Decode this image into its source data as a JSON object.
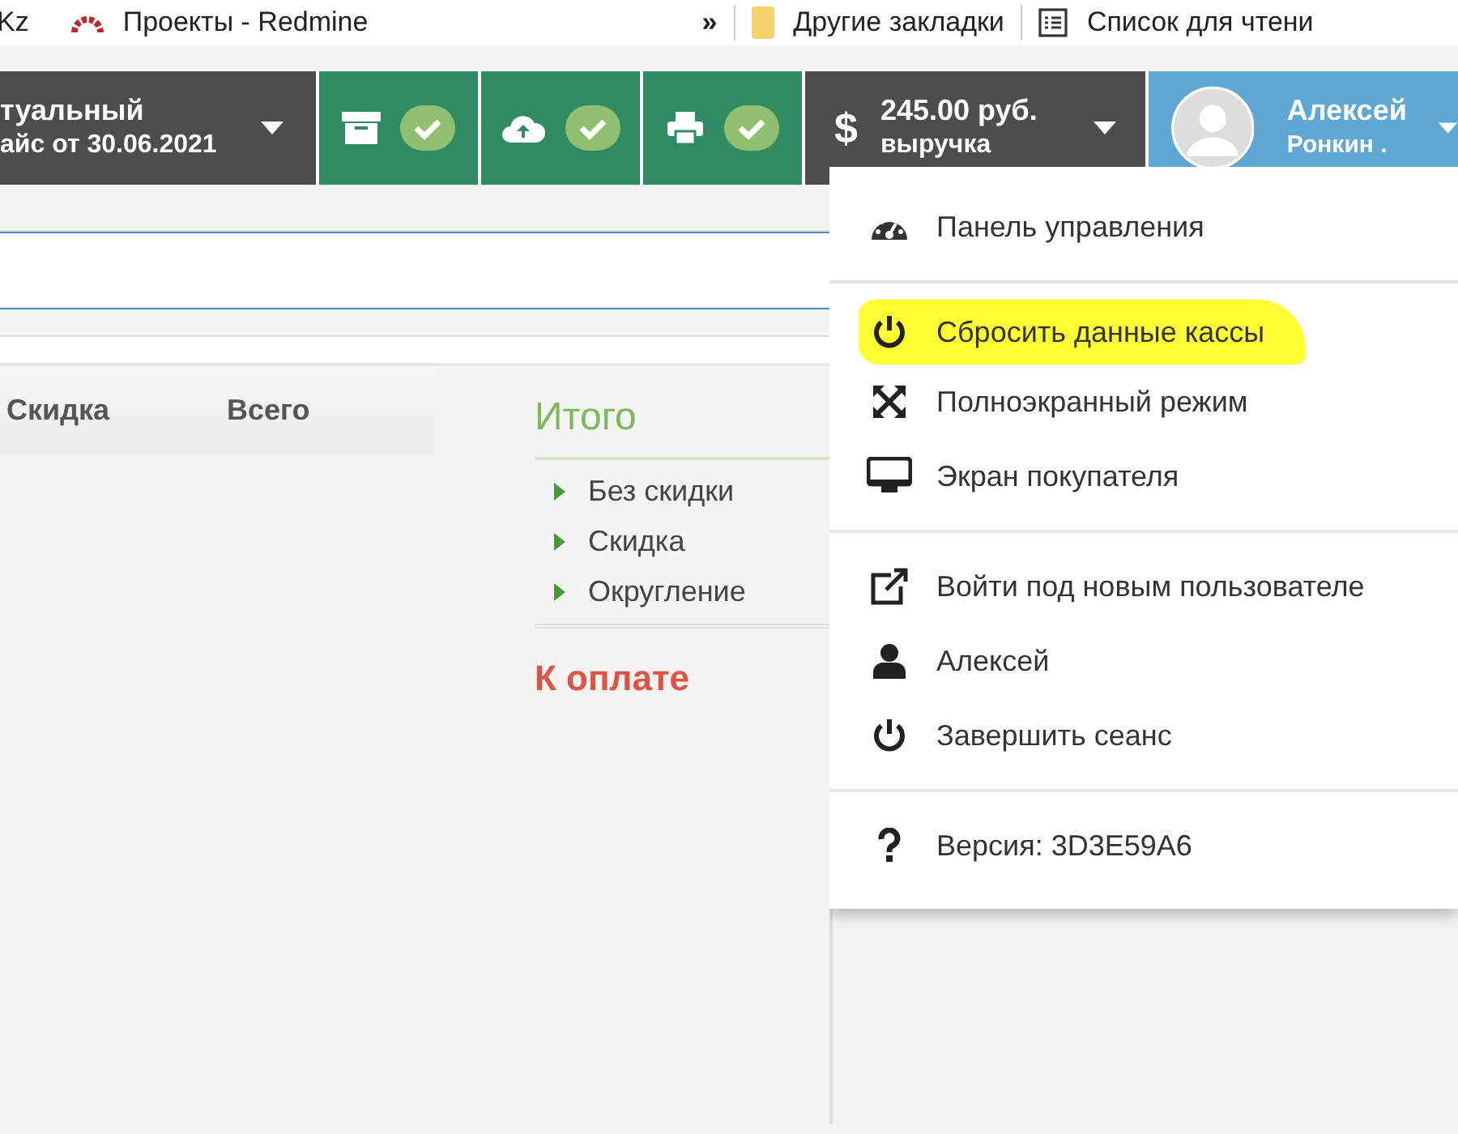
{
  "bookmarks": {
    "items": [
      {
        "kind": "plain",
        "label": "Kz"
      },
      {
        "kind": "redmine",
        "label": "Проекты - Redmine"
      },
      {
        "kind": "more",
        "label": "»"
      },
      {
        "kind": "folder",
        "label": "Другие закладки"
      },
      {
        "kind": "reading",
        "label": "Список для чтени"
      }
    ]
  },
  "top_bar": {
    "segments": [
      {
        "kind": "info",
        "line1": "туальный",
        "line2": "айс от 30.06.2021"
      },
      {
        "kind": "archive",
        "ok": true
      },
      {
        "kind": "cloud",
        "ok": true
      },
      {
        "kind": "printer",
        "ok": true
      },
      {
        "kind": "revenue",
        "symbol": "$",
        "line1": "245.00 руб.",
        "line2": "выручка"
      },
      {
        "kind": "user",
        "line1": "Алексей",
        "line2": "Ронкин ."
      }
    ]
  },
  "table": {
    "columns": [
      "Скидка",
      "Всего"
    ]
  },
  "totals": {
    "title": "Итого",
    "items": [
      "Без скидки",
      "Скидка",
      "Округление"
    ],
    "due": "К оплате"
  },
  "user_menu": {
    "groups": [
      [
        {
          "kind": "gauge",
          "label": "Панель управления",
          "highlighted": false
        }
      ],
      [
        {
          "kind": "power",
          "label": "Сбросить данные кассы",
          "highlighted": true
        },
        {
          "kind": "expand",
          "label": "Полноэкранный режим",
          "highlighted": false
        },
        {
          "kind": "monitor",
          "label": "Экран покупателя",
          "highlighted": false
        }
      ],
      [
        {
          "kind": "external",
          "label": "Войти под новым пользователе",
          "highlighted": false
        },
        {
          "kind": "user",
          "label": "Алексей",
          "highlighted": false
        },
        {
          "kind": "power",
          "label": "Завершить сеанс",
          "highlighted": false
        }
      ],
      [
        {
          "kind": "question",
          "label": "Версия: 3D3E59A6",
          "highlighted": false
        }
      ]
    ]
  }
}
